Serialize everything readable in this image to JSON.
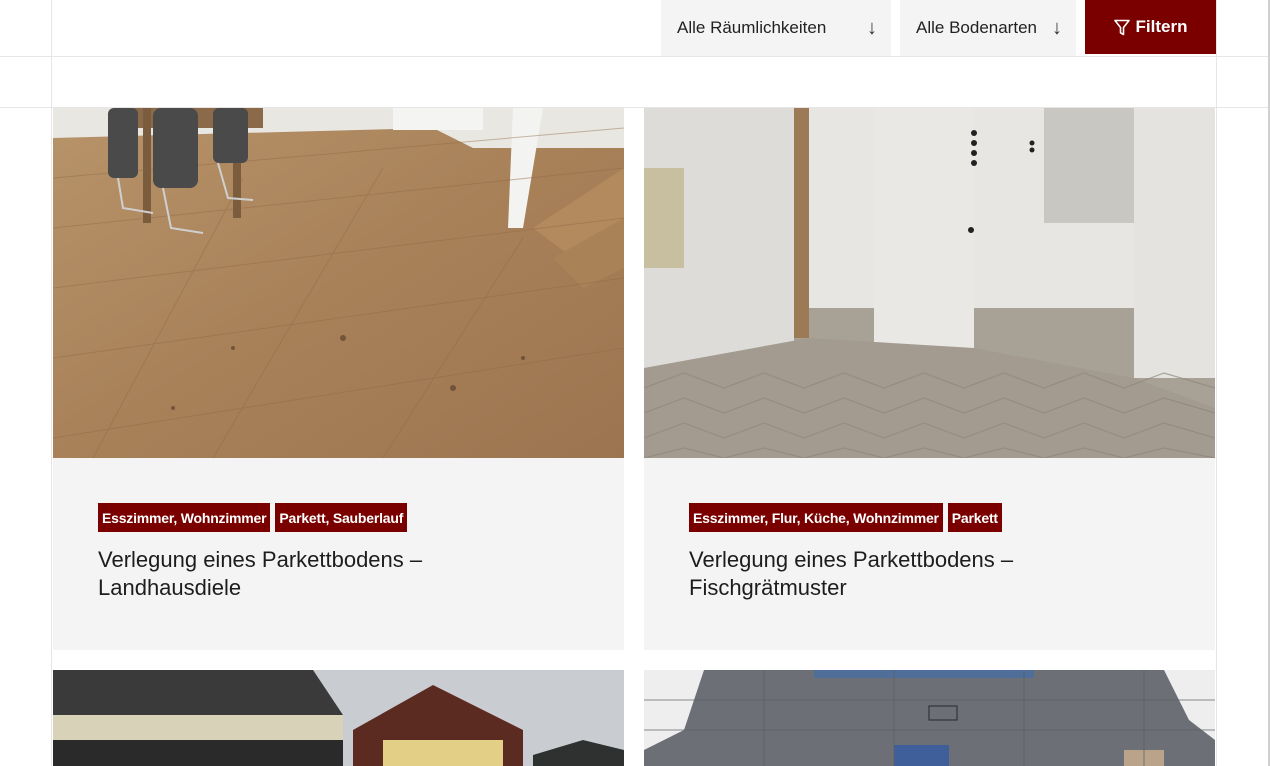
{
  "filters": {
    "rooms_label": "Alle Räumlichkeiten",
    "floors_label": "Alle Bodenarten",
    "filter_button": "Filtern",
    "arrow_glyph": "↓",
    "accent_color": "#7a0000"
  },
  "projects": [
    {
      "tags": [
        "Esszimmer, Wohnzimmer",
        "Parkett, Sauberlauf"
      ],
      "title_line1": "Verlegung eines Parkettbodens –",
      "title_line2": "Landhausdiele"
    },
    {
      "tags": [
        "Esszimmer, Flur, Küche, Wohnzimmer",
        "Parkett"
      ],
      "title_line1": "Verlegung eines Parkettbodens –",
      "title_line2": "Fischgrätmuster"
    }
  ]
}
